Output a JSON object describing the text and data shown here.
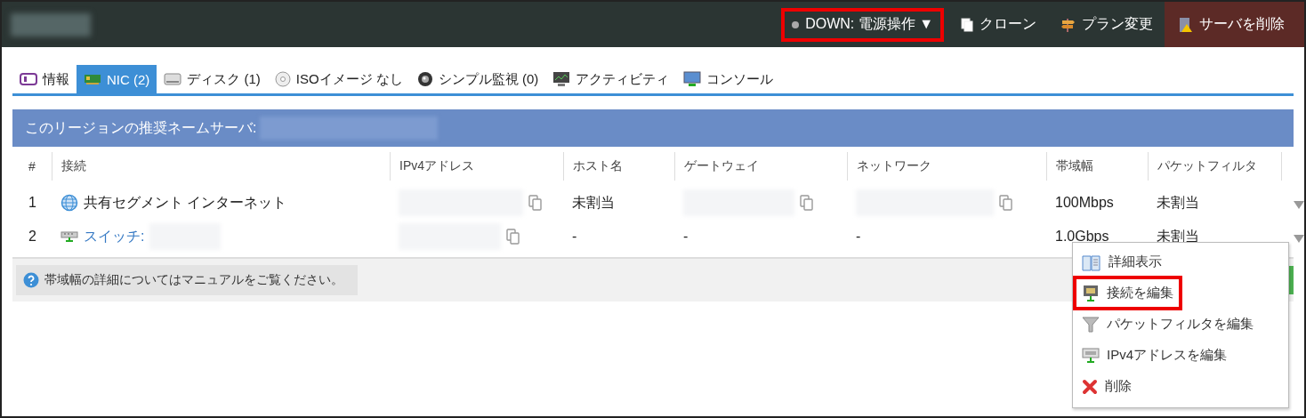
{
  "top_bar": {
    "actions": [
      {
        "kind": "status",
        "label": "DOWN: 電源操作 ▼",
        "highlighted": true
      },
      {
        "kind": "clone",
        "label": "クローン",
        "highlighted": false
      },
      {
        "kind": "plan",
        "label": "プラン変更",
        "highlighted": false
      },
      {
        "kind": "delete",
        "label": "サーバを削除",
        "highlighted": false
      }
    ]
  },
  "tabs": [
    {
      "kind": "info",
      "label": "情報",
      "selected": false
    },
    {
      "kind": "nic",
      "label": "NIC (2)",
      "selected": true
    },
    {
      "kind": "disk",
      "label": "ディスク (1)",
      "selected": false
    },
    {
      "kind": "iso",
      "label": "ISOイメージ なし",
      "selected": false
    },
    {
      "kind": "monitor",
      "label": "シンプル監視 (0)",
      "selected": false
    },
    {
      "kind": "activity",
      "label": "アクティビティ",
      "selected": false
    },
    {
      "kind": "console",
      "label": "コンソール",
      "selected": false
    }
  ],
  "nameserver_bar": {
    "label": "このリージョンの推奨ネームサーバ:"
  },
  "table": {
    "columns": [
      "#",
      "接続",
      "IPv4アドレス",
      "ホスト名",
      "ゲートウェイ",
      "ネットワーク",
      "帯域幅",
      "パケットフィルタ"
    ],
    "rows": [
      {
        "number": "1",
        "connection": {
          "kind": "shared",
          "label": "共有セグメント インターネット"
        },
        "hostname": "未割当",
        "bandwidth": "100Mbps",
        "packet_filter": "未割当"
      },
      {
        "number": "2",
        "connection": {
          "kind": "switch",
          "label": "スイッチ:"
        },
        "hostname": "-",
        "gateway": "-",
        "network": "-",
        "bandwidth": "1.0Gbps",
        "packet_filter": "未割当"
      }
    ]
  },
  "note": "帯域幅の詳細についてはマニュアルをご覧ください。",
  "context_menu": {
    "items": [
      {
        "kind": "details",
        "label": "詳細表示",
        "highlighted": false
      },
      {
        "kind": "connection",
        "label": "接続を編集",
        "highlighted": true
      },
      {
        "kind": "filter",
        "label": "パケットフィルタを編集",
        "highlighted": false
      },
      {
        "kind": "ipv4",
        "label": "IPv4アドレスを編集",
        "highlighted": false
      },
      {
        "kind": "delete",
        "label": "削除",
        "highlighted": false
      }
    ]
  }
}
